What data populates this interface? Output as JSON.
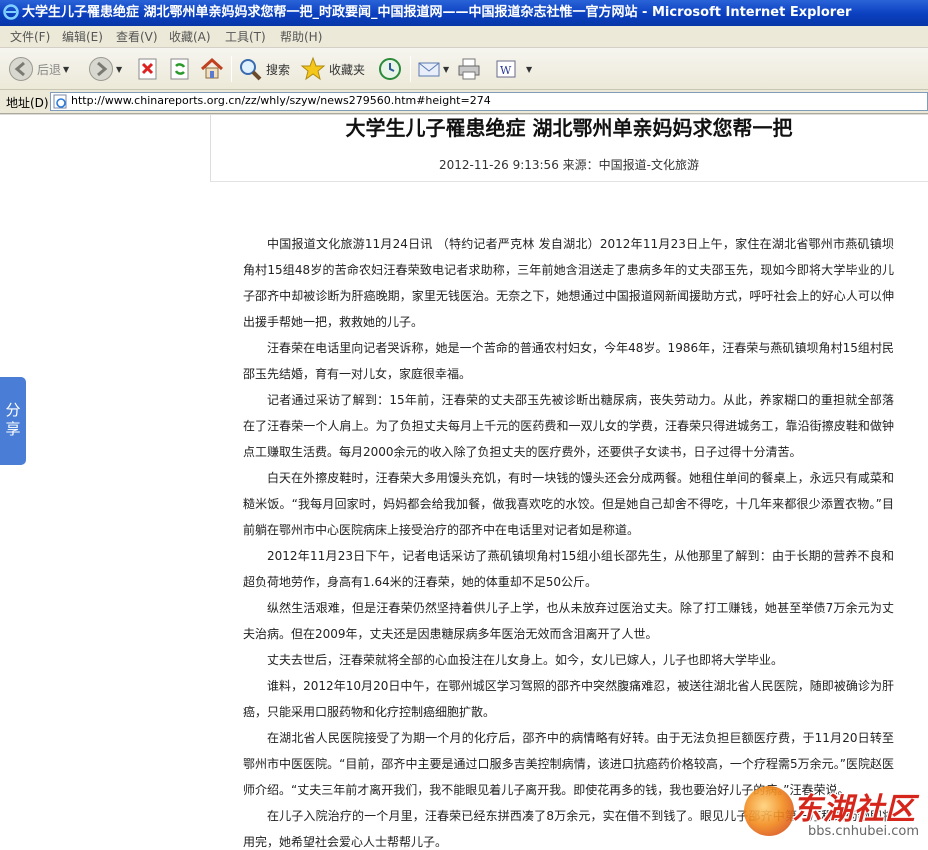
{
  "window": {
    "title": "大学生儿子罹患绝症 湖北鄂州单亲妈妈求您帮一把_时政要闻_中国报道网——中国报道杂志社惟一官方网站 - Microsoft Internet Explorer"
  },
  "menu": [
    {
      "label": "文件(F)"
    },
    {
      "label": "编辑(E)"
    },
    {
      "label": "查看(V)"
    },
    {
      "label": "收藏(A)"
    },
    {
      "label": "工具(T)"
    },
    {
      "label": "帮助(H)"
    }
  ],
  "toolbar": {
    "back_label": "后退",
    "search_label": "搜索",
    "favorites_label": "收藏夹"
  },
  "address": {
    "label": "地址(D)",
    "url": "http://www.chinareports.org.cn/zz/whly/szyw/news279560.htm#height=274"
  },
  "share_label": "分享",
  "article": {
    "headline": "大学生儿子罹患绝症  湖北鄂州单亲妈妈求您帮一把",
    "meta": "2012-11-26  9:13:56  来源：中国报道-文化旅游",
    "paragraphs": [
      "中国报道文化旅游11月24日讯  （特约记者严克林    发自湖北）2012年11月23日上午，家住在湖北省鄂州市燕矶镇坝角村15组48岁的苦命农妇汪春荣致电记者求助称，三年前她含泪送走了患病多年的丈夫邵玉先，现如今即将大学毕业的儿子邵齐中却被诊断为肝癌晚期，家里无钱医治。无奈之下，她想通过中国报道网新闻援助方式，呼吁社会上的好心人可以伸出援手帮她一把，救救她的儿子。",
      "汪春荣在电话里向记者哭诉称，她是一个苦命的普通农村妇女，今年48岁。1986年，汪春荣与燕矶镇坝角村15组村民邵玉先结婚，育有一对儿女，家庭很幸福。",
      "记者通过采访了解到：15年前，汪春荣的丈夫邵玉先被诊断出糖尿病，丧失劳动力。从此，养家糊口的重担就全部落在了汪春荣一个人肩上。为了负担丈夫每月上千元的医药费和一双儿女的学费，汪春荣只得进城务工，靠沿街擦皮鞋和做钟点工赚取生活费。每月2000余元的收入除了负担丈夫的医疗费外，还要供子女读书，日子过得十分清苦。",
      "白天在外擦皮鞋时，汪春荣大多用馒头充饥，有时一块钱的馒头还会分成两餐。她租住单间的餐桌上，永远只有咸菜和糙米饭。“我每月回家时，妈妈都会给我加餐，做我喜欢吃的水饺。但是她自己却舍不得吃，十几年来都很少添置衣物。”目前躺在鄂州市中心医院病床上接受治疗的邵齐中在电话里对记者如是称道。",
      "2012年11月23日下午，记者电话采访了燕矶镇坝角村15组小组长邵先生，从他那里了解到：由于长期的营养不良和超负荷地劳作，身高有1.64米的汪春荣，她的体重却不足50公斤。",
      "纵然生活艰难，但是汪春荣仍然坚持着供儿子上学，也从未放弃过医治丈夫。除了打工赚钱，她甚至举债7万余元为丈夫治病。但在2009年，丈夫还是因患糖尿病多年医治无效而含泪离开了人世。",
      "丈夫去世后，汪春荣就将全部的心血投注在儿女身上。如今，女儿已嫁人，儿子也即将大学毕业。",
      "谁料，2012年10月20日中午，在鄂州城区学习驾照的邵齐中突然腹痛难忍，被送往湖北省人民医院，随即被确诊为肝癌，只能采用口服药物和化疗控制癌细胞扩散。",
      "在湖北省人民医院接受了为期一个月的化疗后，邵齐中的病情略有好转。由于无法负担巨额医疗费，于11月20日转至鄂州市中医医院。“目前，邵齐中主要是通过口服多吉美控制病情，该进口抗癌药价格较高，一个疗程需5万余元。”医院赵医师介绍。“丈夫三年前才离开我们，我不能眼见着儿子离开我。即使花再多的钱，我也要治好儿子的病。”汪春荣说。",
      "在儿子入院治疗的一个月里，汪春荣已经东拼西凑了8万余元，实在借不到钱了。眼见儿子邵齐中第一疗程的药物即将用完，她希望社会爱心人士帮帮儿子。"
    ]
  },
  "watermark": {
    "brand": "东湖社区",
    "url": "bbs.cnhubei.com"
  }
}
